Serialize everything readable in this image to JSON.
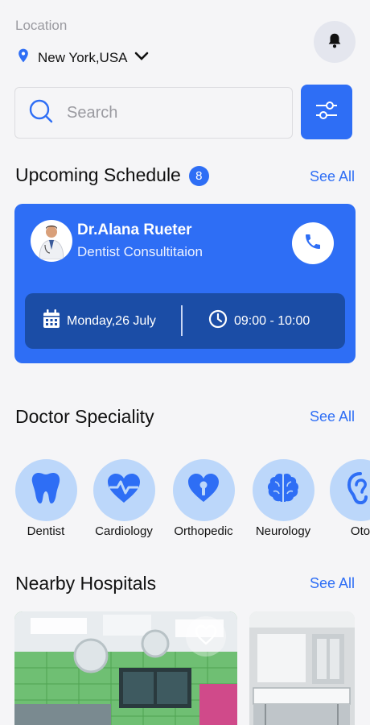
{
  "header": {
    "location_label": "Location",
    "city": "New York,USA"
  },
  "search": {
    "placeholder": "Search"
  },
  "schedule": {
    "title": "Upcoming Schedule",
    "count": "8",
    "see_all": "See All",
    "doctor_name": "Dr.Alana Rueter",
    "specialty": "Dentist Consultitaion",
    "date": "Monday,26 July",
    "time": "09:00 - 10:00"
  },
  "speciality": {
    "title": "Doctor Speciality",
    "see_all": "See All",
    "items": [
      {
        "label": "Dentist",
        "icon": "tooth-icon"
      },
      {
        "label": "Cardiology",
        "icon": "heart-pulse-icon"
      },
      {
        "label": "Orthopedic",
        "icon": "heart-bone-icon"
      },
      {
        "label": "Neurology",
        "icon": "brain-icon"
      },
      {
        "label": "Oto",
        "icon": "ear-icon"
      }
    ]
  },
  "hospitals": {
    "title": "Nearby Hospitals",
    "see_all": "See All"
  },
  "colors": {
    "accent": "#2e6ef5",
    "accent_dark": "#1b4da6",
    "spec_circle": "#bcd7fa",
    "background": "#f5f5f7"
  }
}
